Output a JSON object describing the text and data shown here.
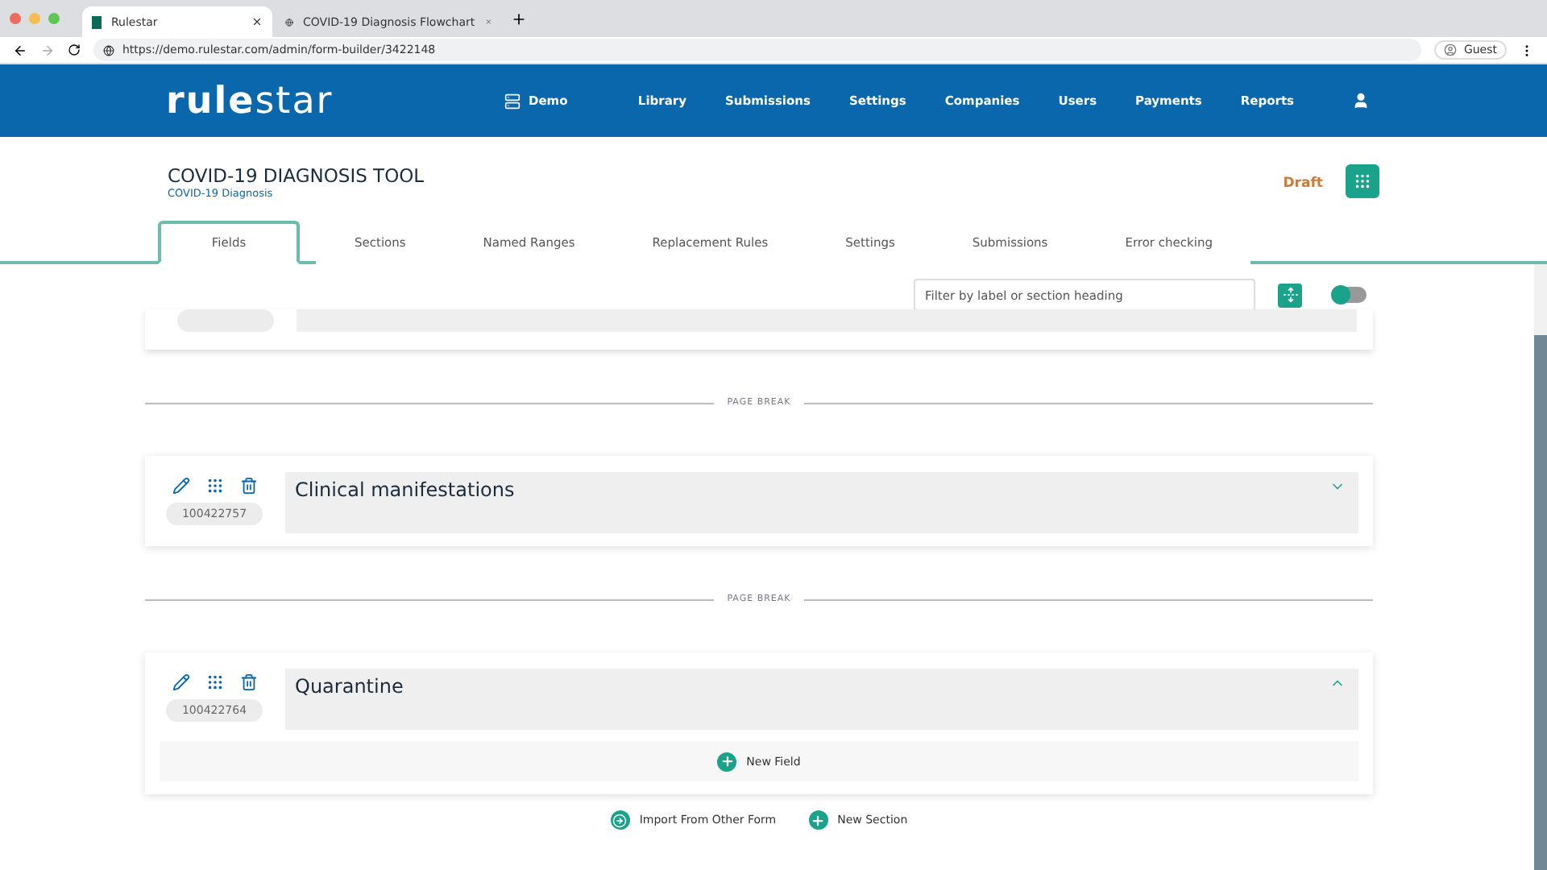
{
  "browser": {
    "tabs": [
      {
        "title": "Rulestar",
        "selected": true
      },
      {
        "title": "COVID-19 Diagnosis Flowchart",
        "selected": false
      }
    ],
    "url": "https://demo.rulestar.com/admin/form-builder/3422148",
    "profile": "Guest"
  },
  "header": {
    "logo_bold": "rule",
    "logo_light": "star",
    "workspace": "Demo",
    "nav": [
      "Library",
      "Submissions",
      "Settings",
      "Companies",
      "Users",
      "Payments",
      "Reports"
    ]
  },
  "form": {
    "title": "COVID-19 DIAGNOSIS TOOL",
    "subtitle": "COVID-19 Diagnosis",
    "status": "Draft"
  },
  "tabs": [
    {
      "label": "Fields",
      "selected": true
    },
    {
      "label": "Sections",
      "selected": false
    },
    {
      "label": "Named Ranges",
      "selected": false
    },
    {
      "label": "Replacement Rules",
      "selected": false
    },
    {
      "label": "Settings",
      "selected": false
    },
    {
      "label": "Submissions",
      "selected": false
    },
    {
      "label": "Error checking",
      "selected": false
    }
  ],
  "toolbar": {
    "filter_placeholder": "Filter by label or section heading",
    "toggle_on": false
  },
  "items": [
    {
      "kind": "partial_section"
    },
    {
      "kind": "page_break",
      "label": "PAGE BREAK"
    },
    {
      "kind": "section",
      "id": "100422757",
      "heading": "Clinical manifestations",
      "expanded": false
    },
    {
      "kind": "page_break",
      "label": "PAGE BREAK"
    },
    {
      "kind": "section",
      "id": "100422764",
      "heading": "Quarantine",
      "expanded": true,
      "new_field": "New Field"
    }
  ],
  "actions": [
    "Import From Other Form",
    "New Section"
  ]
}
